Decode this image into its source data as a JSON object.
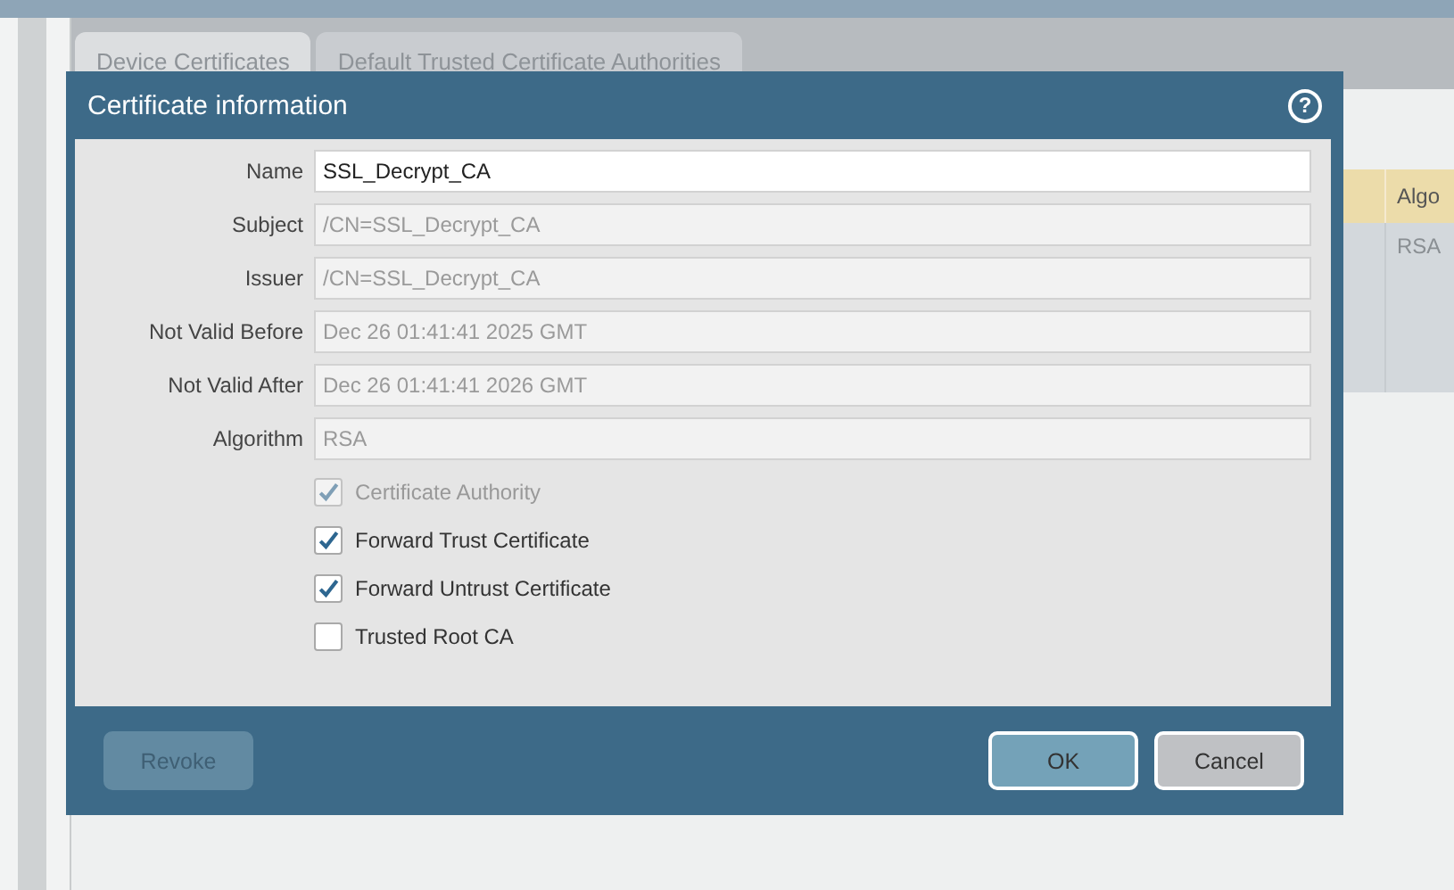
{
  "tabs": [
    {
      "label": "Device Certificates",
      "selected": true
    },
    {
      "label": "Default Trusted Certificate Authorities",
      "selected": false
    }
  ],
  "background_table": {
    "column_header": "Algo",
    "cell": "RSA"
  },
  "dialog": {
    "title": "Certificate information",
    "help": "?",
    "fields": [
      {
        "label": "Name",
        "value": "SSL_Decrypt_CA",
        "disabled": false
      },
      {
        "label": "Subject",
        "value": "/CN=SSL_Decrypt_CA",
        "disabled": true
      },
      {
        "label": "Issuer",
        "value": "/CN=SSL_Decrypt_CA",
        "disabled": true
      },
      {
        "label": "Not Valid Before",
        "value": "Dec 26 01:41:41 2025 GMT",
        "disabled": true
      },
      {
        "label": "Not Valid After",
        "value": "Dec 26 01:41:41 2026 GMT",
        "disabled": true
      },
      {
        "label": "Algorithm",
        "value": "RSA",
        "disabled": true
      }
    ],
    "checkboxes": [
      {
        "label": "Certificate Authority",
        "checked": true,
        "disabled": true
      },
      {
        "label": "Forward Trust Certificate",
        "checked": true,
        "disabled": false
      },
      {
        "label": "Forward Untrust Certificate",
        "checked": true,
        "disabled": false
      },
      {
        "label": "Trusted Root CA",
        "checked": false,
        "disabled": false
      }
    ],
    "buttons": [
      {
        "label": "Revoke",
        "kind": "neutral",
        "disabled": true
      },
      {
        "label": "OK",
        "kind": "primary",
        "disabled": false
      },
      {
        "label": "Cancel",
        "kind": "neutral",
        "disabled": false
      }
    ]
  }
}
